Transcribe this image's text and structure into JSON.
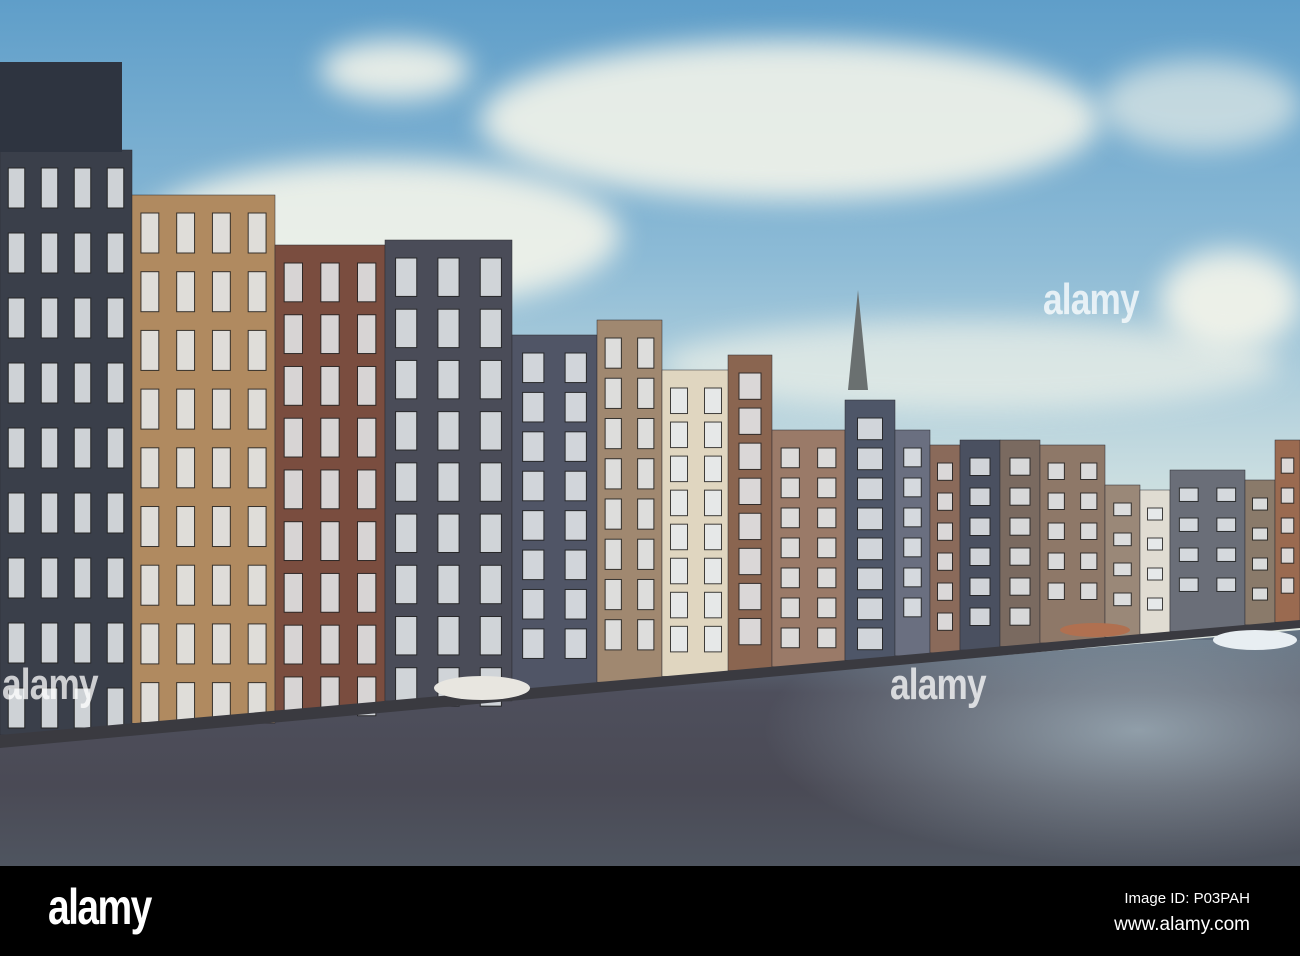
{
  "photo": {
    "colors": {
      "sky": "#8dbbd6",
      "water": "#4a4a55",
      "bar": "#000000"
    }
  },
  "watermark": {
    "text": "alamy"
  },
  "footer": {
    "logo": "alamy",
    "image_id": "Image ID: P03PAH",
    "url": "www.alamy.com"
  }
}
